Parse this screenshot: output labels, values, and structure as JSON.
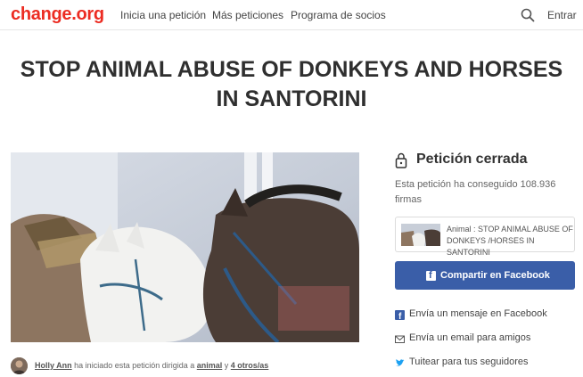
{
  "header": {
    "logo": "change.org",
    "nav": [
      "Inicia una petición",
      "Más peticiones",
      "Programa de socios"
    ],
    "login": "Entrar"
  },
  "petition": {
    "title": "STOP ANIMAL ABUSE OF DONKEYS AND HORSES IN SANTORINI",
    "status": "Petición cerrada",
    "signatures_text": "Esta petición ha conseguido 108.936 firmas",
    "card_text": "Animal : STOP ANIMAL ABUSE OF DONKEYS /HORSES IN SANTORINI"
  },
  "share": {
    "facebook_button": "Compartir en Facebook",
    "messenger": "Envía un mensaje en Facebook",
    "email": "Envía un email para amigos",
    "twitter": "Tuitear para tus seguidores"
  },
  "author": {
    "name": "Holly Ann",
    "middle": " ha iniciado esta petición dirigida a ",
    "target": "animal",
    "conj": " y ",
    "others": "4 otros/as"
  },
  "colors": {
    "brand": "#ec2c22",
    "facebook": "#3a5ea8",
    "twitter": "#1da1f2"
  }
}
